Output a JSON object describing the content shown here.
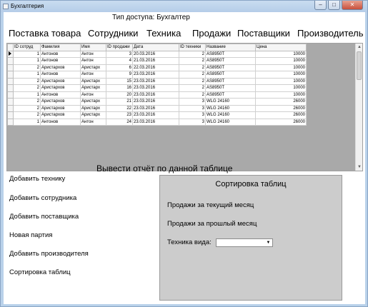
{
  "window": {
    "title": "Бухгалтерия",
    "minimize": "–",
    "maximize": "□",
    "close": "✕"
  },
  "access": {
    "label": "Тип доступа: Бухгалтер"
  },
  "menu": [
    "Поставка товара",
    "Сотрудники",
    "Техника",
    "Продажи",
    "Поставщики",
    "Производитель"
  ],
  "grid": {
    "columns": [
      "ID сотруд",
      "Фамилия",
      "Имя",
      "ID продажи",
      "Дата",
      "ID техники",
      "Название",
      "Цена"
    ],
    "rows": [
      [
        "1",
        "Антонов",
        "Антон",
        "3",
        "20.03.2016",
        "2",
        "AS8950T",
        "10000"
      ],
      [
        "1",
        "Антонов",
        "Антон",
        "4",
        "21.03.2016",
        "2",
        "AS8950T",
        "10000"
      ],
      [
        "2",
        "Аристархов",
        "Аристарх",
        "6",
        "22.03.2016",
        "2",
        "AS8950T",
        "10000"
      ],
      [
        "1",
        "Антонов",
        "Антон",
        "9",
        "23.03.2016",
        "2",
        "AS8950T",
        "10000"
      ],
      [
        "2",
        "Аристархов",
        "Аристарх",
        "15",
        "23.03.2016",
        "2",
        "AS8950T",
        "10000"
      ],
      [
        "2",
        "Аристархов",
        "Аристарх",
        "16",
        "23.03.2016",
        "2",
        "AS8950T",
        "10000"
      ],
      [
        "1",
        "Антонов",
        "Антон",
        "20",
        "23.03.2016",
        "2",
        "AS8950T",
        "10000"
      ],
      [
        "2",
        "Аристархов",
        "Аристарх",
        "21",
        "23.03.2016",
        "3",
        "WLG 24160",
        "26000"
      ],
      [
        "2",
        "Аристархов",
        "Аристарх",
        "22",
        "23.03.2016",
        "3",
        "WLG 24160",
        "26000"
      ],
      [
        "2",
        "Аристархов",
        "Аристарх",
        "23",
        "23.03.2016",
        "3",
        "WLG 24160",
        "26000"
      ],
      [
        "1",
        "Антонов",
        "Антон",
        "24",
        "23.03.2016",
        "3",
        "WLG 24160",
        "26000"
      ]
    ]
  },
  "report": {
    "title": "Вывести отчёт по данной таблице"
  },
  "actions": [
    "Добавить технику",
    "Добавить сотрудника",
    "Добавить поставщика",
    "Новая партия",
    "Добавить производителя",
    "Сортировка таблиц"
  ],
  "panel": {
    "title": "Сортировка таблиц",
    "current_month": "Продажи за текущий месяц",
    "last_month": "Продажи за прошлый месяц",
    "tech_type_label": "Техника вида:",
    "tech_type_value": ""
  }
}
